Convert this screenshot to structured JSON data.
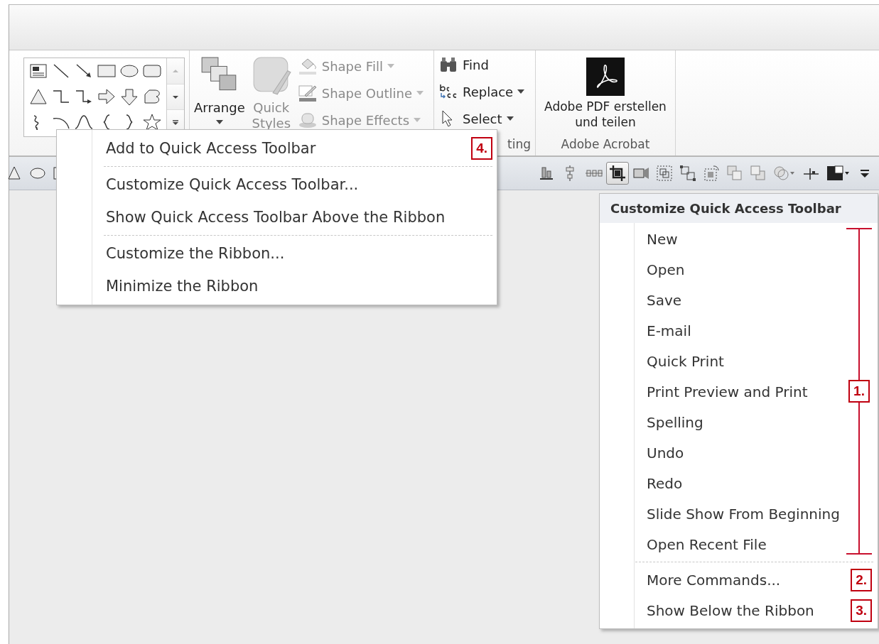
{
  "ribbon": {
    "groups": [
      {
        "kind": "shapes"
      },
      {
        "kind": "drawing",
        "arrange": {
          "label": "Arrange"
        },
        "quick_styles": {
          "label": "Quick Styles",
          "disabled": true
        },
        "commands": [
          {
            "label": "Shape Fill",
            "kind": "fill",
            "disabled": true
          },
          {
            "label": "Shape Outline",
            "kind": "outline",
            "disabled": true
          },
          {
            "label": "Shape Effects",
            "kind": "effects",
            "disabled": true
          }
        ]
      },
      {
        "kind": "editing",
        "label": "ting",
        "commands": [
          {
            "label": "Find",
            "kind": "find",
            "dropdown": false
          },
          {
            "label": "Replace",
            "kind": "replace",
            "dropdown": true
          },
          {
            "label": "Select",
            "kind": "select",
            "dropdown": true
          }
        ]
      },
      {
        "kind": "acrobat",
        "label": "Adobe Acrobat",
        "button": "Adobe PDF erstellen und teilen"
      }
    ]
  },
  "quick_access_toolbar": {
    "left": [
      {
        "kind": "triangle"
      },
      {
        "kind": "oval"
      },
      {
        "kind": "rect"
      }
    ],
    "right": [
      {
        "kind": "align-bottom",
        "selected": false
      },
      {
        "kind": "align-middle",
        "selected": false
      },
      {
        "kind": "distribute",
        "selected": false
      },
      {
        "kind": "crop",
        "selected": true
      },
      {
        "kind": "shadow",
        "selected": false
      },
      {
        "kind": "group",
        "selected": false
      },
      {
        "kind": "ungroup",
        "selected": false
      },
      {
        "kind": "regroup",
        "selected": false
      },
      {
        "kind": "forward",
        "selected": false
      },
      {
        "kind": "backward",
        "selected": false
      },
      {
        "kind": "combine",
        "selected": false
      },
      {
        "kind": "connector",
        "selected": false
      },
      {
        "kind": "color",
        "selected": false
      },
      {
        "kind": "more",
        "selected": false
      }
    ]
  },
  "context_menu": {
    "items": [
      {
        "label": "Add to Quick Access Toolbar",
        "annotation": "4."
      },
      {
        "kind": "separator"
      },
      {
        "label": "Customize Quick Access Toolbar..."
      },
      {
        "label": "Show Quick Access Toolbar Above the Ribbon"
      },
      {
        "kind": "separator"
      },
      {
        "label": "Customize the Ribbon..."
      },
      {
        "label": "Minimize the Ribbon"
      }
    ]
  },
  "qat_menu": {
    "title": "Customize Quick Access Toolbar",
    "commands_annotation": "1.",
    "commands": [
      "New",
      "Open",
      "Save",
      "E-mail",
      "Quick Print",
      "Print Preview and Print",
      "Spelling",
      "Undo",
      "Redo",
      "Slide Show From Beginning",
      "Open Recent File"
    ],
    "options": [
      {
        "label": "More Commands...",
        "annotation": "2."
      },
      {
        "label": "Show Below the Ribbon",
        "annotation": "3."
      }
    ]
  }
}
